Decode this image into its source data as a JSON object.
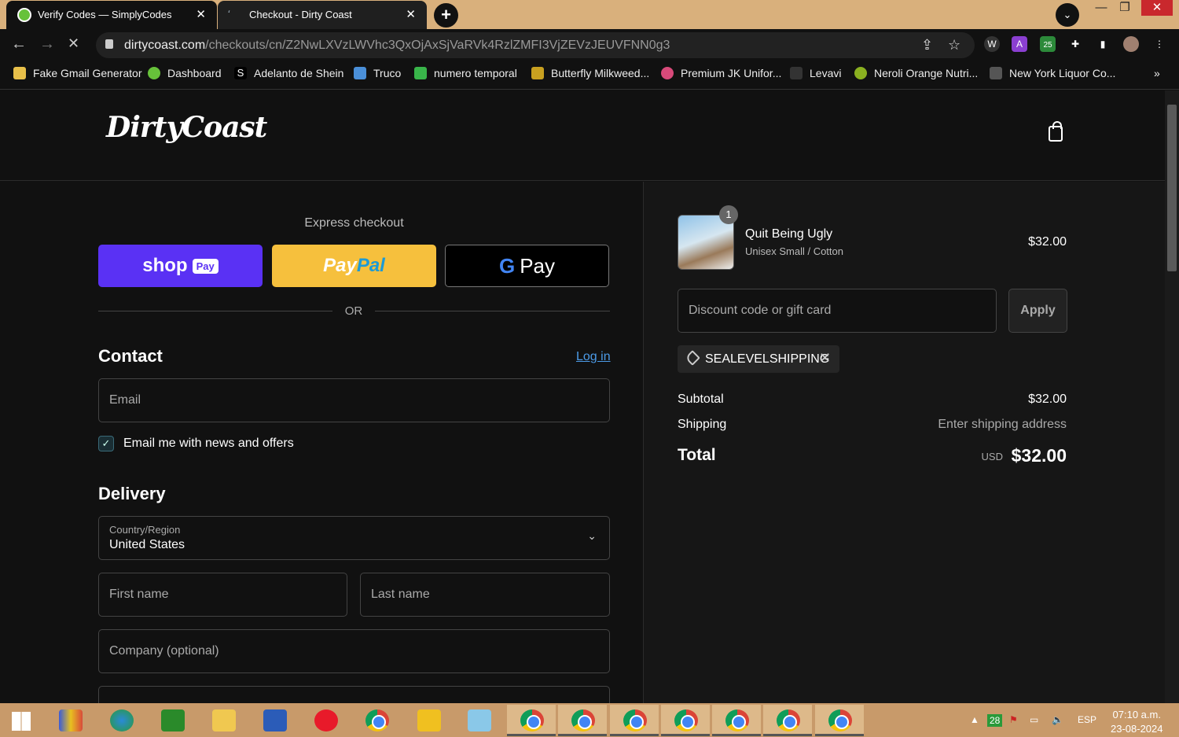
{
  "browser": {
    "tabs": [
      {
        "title": "Verify Codes — SimplyCodes",
        "active": true
      },
      {
        "title": "Checkout - Dirty Coast",
        "active": false
      }
    ],
    "new_tab": "+",
    "url_domain": "dirtycoast.com",
    "url_path": "/checkouts/cn/Z2NwLXVzLWVhc3QxOjAxSjVaRVk4RzlZMFI3VjZEVzJEUVFNN0g3",
    "extension_badge": "25",
    "bookmarks": [
      {
        "label": "Fake Gmail Generator",
        "color": "#e8c04a"
      },
      {
        "label": "Dashboard",
        "color": "#67c23a"
      },
      {
        "label": "Adelanto de Shein",
        "color": "#000000",
        "glyph": "S"
      },
      {
        "label": "Truco",
        "color": "#4a8fd8"
      },
      {
        "label": "numero temporal",
        "color": "#39b54a"
      },
      {
        "label": "Butterfly Milkweed...",
        "color": "#c8a020"
      },
      {
        "label": "Premium JK Unifor...",
        "color": "#d84a7a"
      },
      {
        "label": "Levavi",
        "color": "#333333"
      },
      {
        "label": "Neroli Orange Nutri...",
        "color": "#8ab020"
      },
      {
        "label": "New York Liquor Co...",
        "color": "#555555"
      }
    ],
    "bookmarks_more": "»"
  },
  "store": {
    "logo": "DirtyCoast",
    "express_checkout": "Express checkout",
    "shop_pay": {
      "shop": "shop",
      "pay": "Pay"
    },
    "paypal": {
      "pay": "Pay",
      "pal": "Pal"
    },
    "gpay": {
      "g": "G",
      "pay": "Pay"
    },
    "or": "OR",
    "contact": {
      "title": "Contact",
      "login": "Log in",
      "email_placeholder": "Email",
      "newsletter_label": "Email me with news and offers",
      "newsletter_checked": true
    },
    "delivery": {
      "title": "Delivery",
      "country_label": "Country/Region",
      "country_value": "United States",
      "first_name": "First name",
      "last_name": "Last name",
      "company": "Company (optional)"
    }
  },
  "summary": {
    "product": {
      "name": "Quit Being Ugly",
      "variant": "Unisex Small / Cotton",
      "price": "$32.00",
      "quantity": "1"
    },
    "discount_placeholder": "Discount code or gift card",
    "apply": "Apply",
    "applied_code": "SEALEVELSHIPPING",
    "subtotal_label": "Subtotal",
    "subtotal": "$32.00",
    "shipping_label": "Shipping",
    "shipping": "Enter shipping address",
    "total_label": "Total",
    "currency": "USD",
    "total": "$32.00"
  },
  "taskbar": {
    "badge": "28",
    "language": "ESP",
    "time": "07:10 a.m.",
    "date": "23-08-2024"
  }
}
